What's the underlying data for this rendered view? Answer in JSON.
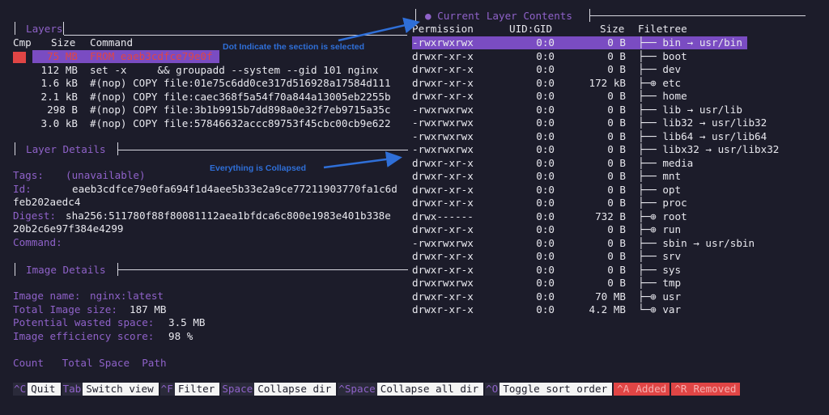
{
  "layers": {
    "title": "Layers",
    "headers": {
      "cmp": "Cmp",
      "size": "Size",
      "command": "Command"
    },
    "rows": [
      {
        "size": "75 MB",
        "command": "FROM eaeb3cdfce79e0f"
      },
      {
        "size": "112 MB",
        "command": "set -x     && groupadd --system --gid 101 nginx"
      },
      {
        "size": "1.6 kB",
        "command": "#(nop) COPY file:01e75c6dd0ce317d516928a17584d111"
      },
      {
        "size": "2.1 kB",
        "command": "#(nop) COPY file:caec368f5a54f70a844a13005eb2255b"
      },
      {
        "size": "298 B",
        "command": "#(nop) COPY file:3b1b9915b7dd898a0e32f7eb9715a35c"
      },
      {
        "size": "3.0 kB",
        "command": "#(nop) COPY file:57846632accc89753f45cbc00cb9e622"
      }
    ]
  },
  "layer_details": {
    "title": "Layer Details",
    "tags_label": "Tags:",
    "tags_value": "(unavailable)",
    "id_label": "Id:",
    "id_value_1": "eaeb3cdfce79e0fa694f1d4aee5b33e2a9ce77211903770fa1c6d",
    "id_value_2": "feb202aedc4",
    "digest_label": "Digest:",
    "digest_value_1": "sha256:511780f88f80081112aea1bfdca6c800e1983e401b338e",
    "digest_value_2": "20b2c6e97f384e4299",
    "command_label": "Command:"
  },
  "image_details": {
    "title": "Image Details",
    "name_label": "Image name:",
    "name_value": "nginx:latest",
    "size_label": "Total Image size:",
    "size_value": "187 MB",
    "wasted_label": "Potential wasted space:",
    "wasted_value": "3.5 MB",
    "efficiency_label": "Image efficiency score:",
    "efficiency_value": "98 %",
    "headers": "Count   Total Space  Path"
  },
  "layer_contents": {
    "title": "● Current Layer Contents",
    "headers": {
      "permission": "Permission",
      "uidgid": "UID:GID",
      "size": "Size",
      "filetree": "Filetree"
    },
    "rows": [
      {
        "perm": "-rwxrwxrwx",
        "uid": "0:0",
        "size": "0 B",
        "tree": "├── bin → usr/bin"
      },
      {
        "perm": "drwxr-xr-x",
        "uid": "0:0",
        "size": "0 B",
        "tree": "├── boot"
      },
      {
        "perm": "drwxr-xr-x",
        "uid": "0:0",
        "size": "0 B",
        "tree": "├── dev"
      },
      {
        "perm": "drwxr-xr-x",
        "uid": "0:0",
        "size": "172 kB",
        "tree": "├─⊕ etc"
      },
      {
        "perm": "drwxr-xr-x",
        "uid": "0:0",
        "size": "0 B",
        "tree": "├── home"
      },
      {
        "perm": "-rwxrwxrwx",
        "uid": "0:0",
        "size": "0 B",
        "tree": "├── lib → usr/lib"
      },
      {
        "perm": "-rwxrwxrwx",
        "uid": "0:0",
        "size": "0 B",
        "tree": "├── lib32 → usr/lib32"
      },
      {
        "perm": "-rwxrwxrwx",
        "uid": "0:0",
        "size": "0 B",
        "tree": "├── lib64 → usr/lib64"
      },
      {
        "perm": "-rwxrwxrwx",
        "uid": "0:0",
        "size": "0 B",
        "tree": "├── libx32 → usr/libx32"
      },
      {
        "perm": "drwxr-xr-x",
        "uid": "0:0",
        "size": "0 B",
        "tree": "├── media"
      },
      {
        "perm": "drwxr-xr-x",
        "uid": "0:0",
        "size": "0 B",
        "tree": "├── mnt"
      },
      {
        "perm": "drwxr-xr-x",
        "uid": "0:0",
        "size": "0 B",
        "tree": "├── opt"
      },
      {
        "perm": "drwxr-xr-x",
        "uid": "0:0",
        "size": "0 B",
        "tree": "├── proc"
      },
      {
        "perm": "drwx------",
        "uid": "0:0",
        "size": "732 B",
        "tree": "├─⊕ root"
      },
      {
        "perm": "drwxr-xr-x",
        "uid": "0:0",
        "size": "0 B",
        "tree": "├─⊕ run"
      },
      {
        "perm": "-rwxrwxrwx",
        "uid": "0:0",
        "size": "0 B",
        "tree": "├── sbin → usr/sbin"
      },
      {
        "perm": "drwxr-xr-x",
        "uid": "0:0",
        "size": "0 B",
        "tree": "├── srv"
      },
      {
        "perm": "drwxr-xr-x",
        "uid": "0:0",
        "size": "0 B",
        "tree": "├── sys"
      },
      {
        "perm": "drwxrwxrwx",
        "uid": "0:0",
        "size": "0 B",
        "tree": "├── tmp"
      },
      {
        "perm": "drwxr-xr-x",
        "uid": "0:0",
        "size": "70 MB",
        "tree": "├─⊕ usr"
      },
      {
        "perm": "drwxr-xr-x",
        "uid": "0:0",
        "size": "4.2 MB",
        "tree": "└─⊕ var"
      }
    ]
  },
  "annotations": {
    "dot": "Dot Indicate the section is selected",
    "collapsed": "Everything is Collapsed"
  },
  "footer": [
    {
      "key": "^C",
      "label": "Quit"
    },
    {
      "key": "Tab",
      "label": "Switch view"
    },
    {
      "key": "^F",
      "label": "Filter"
    },
    {
      "key": "Space",
      "label": "Collapse dir"
    },
    {
      "key": "^Space",
      "label": "Collapse all dir"
    },
    {
      "key": "^O",
      "label": "Toggle sort order"
    },
    {
      "key": "^A",
      "label": "Added",
      "alert": true
    },
    {
      "key": "^R",
      "label": "Removed",
      "alert": true
    }
  ],
  "colors": {
    "accent": "#8f62c9",
    "selection": "#7a4cc2",
    "alert": "#e04545",
    "annotation": "#2f6fd8",
    "background": "#1c1c2a"
  }
}
